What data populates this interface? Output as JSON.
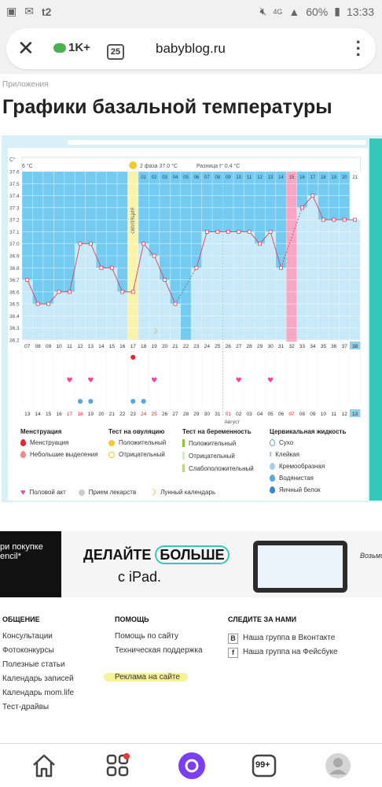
{
  "status_bar": {
    "carrier": "t2",
    "network": "4G",
    "battery": "60%",
    "time": "13:33"
  },
  "browser": {
    "domain": "babyblog.ru",
    "community_count": "1K+",
    "tab_count": "25"
  },
  "breadcrumb": "Приложения",
  "page_title": "Графики базальной температуры",
  "chart": {
    "unit_label": "C°",
    "left_header_temp": "6 °C",
    "ovulation_label": "ОВУЛЯЦИЯ",
    "phase_label": "2 фаза 37.0 °C",
    "diff_label": "Разница t° 0.4 °C",
    "month_label": "Август"
  },
  "chart_data": {
    "type": "line",
    "ylabel": "C°",
    "ylim": [
      36.2,
      37.6
    ],
    "y_ticks": [
      "37.6",
      "37.5",
      "37.4",
      "37.3",
      "37.2",
      "37.1",
      "37.0",
      "36.9",
      "36.8",
      "36.7",
      "36.6",
      "36.5",
      "36.4",
      "36.3",
      "36.2"
    ],
    "cycle_days": [
      "07",
      "08",
      "09",
      "10",
      "11",
      "12",
      "13",
      "14",
      "15",
      "16",
      "17",
      "18",
      "19",
      "20",
      "21",
      "22",
      "23",
      "24",
      "25",
      "26",
      "27",
      "28",
      "29",
      "30",
      "31",
      "32",
      "33",
      "34",
      "35",
      "36",
      "37",
      "38"
    ],
    "dates": [
      "13",
      "14",
      "15",
      "16",
      "17",
      "18",
      "19",
      "20",
      "21",
      "22",
      "23",
      "24",
      "25",
      "26",
      "27",
      "28",
      "29",
      "30",
      "31",
      "01",
      "02",
      "03",
      "04",
      "05",
      "06",
      "07",
      "08",
      "09",
      "10",
      "11",
      "12",
      "13"
    ],
    "phase2_days": [
      "01",
      "02",
      "03",
      "04",
      "05",
      "06",
      "07",
      "08",
      "09",
      "10",
      "11",
      "12",
      "13",
      "14",
      "15",
      "16",
      "17",
      "18",
      "19",
      "20",
      "21"
    ],
    "temperatures": [
      36.7,
      36.5,
      36.5,
      36.6,
      36.6,
      37.0,
      37.0,
      36.8,
      36.8,
      36.6,
      36.6,
      37.0,
      36.9,
      36.7,
      36.5,
      null,
      36.8,
      37.1,
      37.1,
      37.1,
      37.1,
      37.1,
      37.0,
      37.1,
      36.8,
      null,
      37.3,
      37.4,
      37.2,
      37.2,
      37.2,
      37.2
    ],
    "ovulation_day_index": 10,
    "excluded_day_index": 25,
    "menstruation_day_index": 10,
    "sex_day_indices": [
      4,
      6,
      12,
      20,
      23
    ],
    "fluid_day_indices": [
      5,
      6,
      10,
      11
    ],
    "moon_day_index": 12,
    "highlight_dates_red": [
      "17",
      "18",
      "24",
      "25",
      "01",
      "07"
    ]
  },
  "legend": {
    "menstruation": {
      "title": "Менструация",
      "items": [
        "Менструация",
        "Небольшие выделения"
      ]
    },
    "ovulation_test": {
      "title": "Тест на овуляцию",
      "items": [
        "Положительный",
        "Отрицательный"
      ]
    },
    "pregnancy_test": {
      "title": "Тест на беременность",
      "items": [
        "Положительный",
        "Отрицательный",
        "Слабоположительный"
      ]
    },
    "cervical": {
      "title": "Цервикальная жидкость",
      "items": [
        "Сухо",
        "Клейкая",
        "Кремообразная",
        "Водянистая",
        "Яичный белок"
      ]
    },
    "bottom": [
      "Половой акт",
      "Прием лекарств",
      "Лунный календарь"
    ],
    "colors": {
      "pink": "#f0479a",
      "red": "#e3262f",
      "yellow": "#f7c92f",
      "green": "#8cc63f",
      "blue": "#5da5dc"
    }
  },
  "ad": {
    "left_line1": "ри покупке",
    "left_line2": "encil*",
    "line1a": "ДЕЛАЙТЕ",
    "line1b": "БОЛЬШЕ",
    "line2": "с iPad.",
    "right_text": "Возьми"
  },
  "footer": {
    "col1": {
      "title": "ОБЩЕНИЕ",
      "links": [
        "Консультации",
        "Фотоконкурсы",
        "Полезные статьи",
        "Календарь записей",
        "Календарь mom.life",
        "Тест-драйвы"
      ]
    },
    "col2": {
      "title": "ПОМОЩЬ",
      "links": [
        "Помощь по сайту",
        "Техническая поддержка",
        "Реклама на сайте"
      ]
    },
    "col3": {
      "title": "СЛЕДИТЕ ЗА НАМИ",
      "links": [
        "Наша группа в Вконтакте",
        "Наша группа на Фейсбуке"
      ]
    }
  },
  "navbar": {
    "badge_count": "99+"
  }
}
